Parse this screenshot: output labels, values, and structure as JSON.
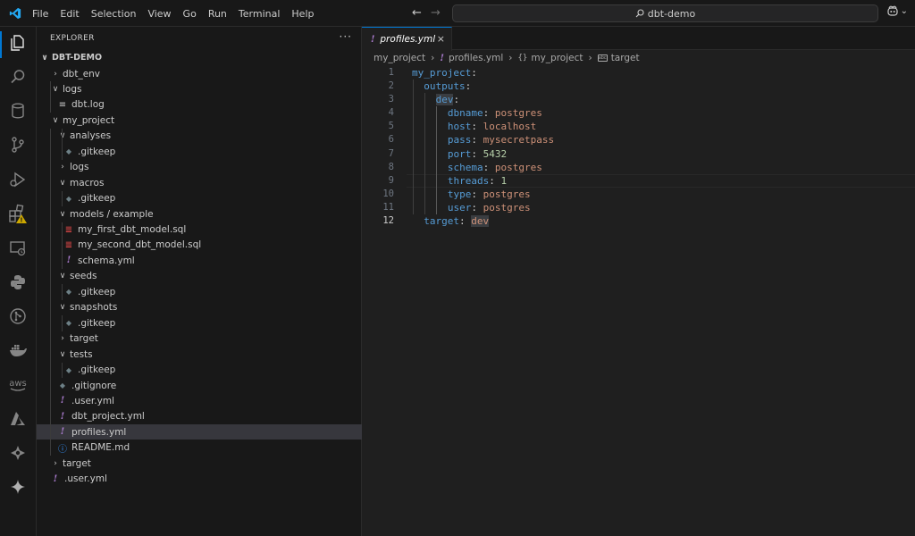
{
  "menu": [
    "File",
    "Edit",
    "Selection",
    "View",
    "Go",
    "Run",
    "Terminal",
    "Help"
  ],
  "search": {
    "text": "dbt-demo"
  },
  "colors": {
    "accent": "#0078d4",
    "key": "#569cd6",
    "string": "#ce9178",
    "number": "#b5cea8"
  },
  "activity_icons": [
    "files-icon",
    "search-icon",
    "database-icon",
    "source-control-icon",
    "run-debug-icon",
    "extensions-icon",
    "remote-explorer-icon",
    "python-icon",
    "github-icon",
    "docker-icon",
    "aws-icon",
    "azure-icon",
    "dbt-icon",
    "sparkle-icon"
  ],
  "explorer": {
    "title": "EXPLORER",
    "more": "···",
    "root": "DBT-DEMO",
    "items": [
      {
        "label": "dbt_env",
        "type": "folder",
        "open": false,
        "depth": 1
      },
      {
        "label": "logs",
        "type": "folder",
        "open": true,
        "depth": 1
      },
      {
        "label": "dbt.log",
        "type": "log",
        "depth": 2
      },
      {
        "label": "my_project",
        "type": "folder",
        "open": true,
        "depth": 1
      },
      {
        "label": "analyses",
        "type": "folder",
        "open": true,
        "depth": 2
      },
      {
        "label": ".gitkeep",
        "type": "git",
        "depth": 3
      },
      {
        "label": "logs",
        "type": "folder",
        "open": false,
        "depth": 2
      },
      {
        "label": "macros",
        "type": "folder",
        "open": true,
        "depth": 2
      },
      {
        "label": ".gitkeep",
        "type": "git",
        "depth": 3
      },
      {
        "label": "models / example",
        "type": "folder",
        "open": true,
        "depth": 2
      },
      {
        "label": "my_first_dbt_model.sql",
        "type": "sql",
        "depth": 3
      },
      {
        "label": "my_second_dbt_model.sql",
        "type": "sql",
        "depth": 3
      },
      {
        "label": "schema.yml",
        "type": "yml",
        "depth": 3
      },
      {
        "label": "seeds",
        "type": "folder",
        "open": true,
        "depth": 2
      },
      {
        "label": ".gitkeep",
        "type": "git",
        "depth": 3
      },
      {
        "label": "snapshots",
        "type": "folder",
        "open": true,
        "depth": 2
      },
      {
        "label": ".gitkeep",
        "type": "git",
        "depth": 3
      },
      {
        "label": "target",
        "type": "folder",
        "open": false,
        "depth": 2
      },
      {
        "label": "tests",
        "type": "folder",
        "open": true,
        "depth": 2
      },
      {
        "label": ".gitkeep",
        "type": "git",
        "depth": 3
      },
      {
        "label": ".gitignore",
        "type": "gitignore",
        "depth": 2
      },
      {
        "label": ".user.yml",
        "type": "yml",
        "depth": 2
      },
      {
        "label": "dbt_project.yml",
        "type": "yml",
        "depth": 2
      },
      {
        "label": "profiles.yml",
        "type": "yml",
        "depth": 2,
        "selected": true
      },
      {
        "label": "README.md",
        "type": "info",
        "depth": 2
      },
      {
        "label": "target",
        "type": "folder",
        "open": false,
        "depth": 1
      },
      {
        "label": ".user.yml",
        "type": "yml",
        "depth": 1
      }
    ]
  },
  "editor": {
    "tab": {
      "label": "profiles.yml",
      "close": "×"
    },
    "breadcrumbs": [
      "my_project",
      "profiles.yml",
      "my_project",
      "target"
    ],
    "lines": [
      {
        "n": "1",
        "indent": 0,
        "key": "my_project",
        "value": ""
      },
      {
        "n": "2",
        "indent": 1,
        "key": "outputs",
        "value": ""
      },
      {
        "n": "3",
        "indent": 2,
        "key": "dev",
        "value": "",
        "highlight_key": true
      },
      {
        "n": "4",
        "indent": 3,
        "key": "dbname",
        "value": "postgres"
      },
      {
        "n": "5",
        "indent": 3,
        "key": "host",
        "value": "localhost"
      },
      {
        "n": "6",
        "indent": 3,
        "key": "pass",
        "value": "mysecretpass"
      },
      {
        "n": "7",
        "indent": 3,
        "key": "port",
        "value": "5432",
        "numeric": true
      },
      {
        "n": "8",
        "indent": 3,
        "key": "schema",
        "value": "postgres"
      },
      {
        "n": "9",
        "indent": 3,
        "key": "threads",
        "value": "1",
        "numeric": true
      },
      {
        "n": "10",
        "indent": 3,
        "key": "type",
        "value": "postgres"
      },
      {
        "n": "11",
        "indent": 3,
        "key": "user",
        "value": "postgres"
      },
      {
        "n": "12",
        "indent": 1,
        "key": "target",
        "value": "dev",
        "highlight_value": true,
        "active": true
      }
    ]
  }
}
